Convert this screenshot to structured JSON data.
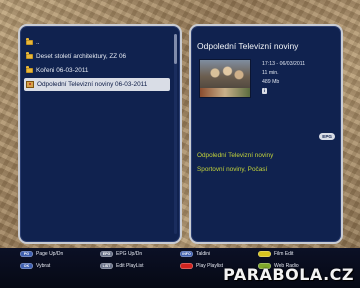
{
  "file_browser": {
    "items": [
      {
        "label": "..",
        "icon": "folder-icon",
        "selected": false
      },
      {
        "label": "Deset století architektury, ZZ 06",
        "icon": "folder-icon",
        "selected": false
      },
      {
        "label": "Kořeni 06-03-2011",
        "icon": "folder-icon",
        "selected": false
      },
      {
        "label": "Odpolední Televizní noviny 06-03-2011",
        "icon": "recording-icon",
        "selected": true
      }
    ]
  },
  "details": {
    "title": "Odpolední Televizní noviny",
    "time_range": "17:13 - 06/03/2011",
    "duration": "11 min.",
    "size": "489 Mb",
    "info_badge": "i",
    "epg_button": "EPG",
    "epg_title": "Odpolední Televizní noviny",
    "epg_desc": "Sportovní noviny, Počasí"
  },
  "legend": [
    {
      "key_color": "blue",
      "key_text": "PG",
      "label": "Page Up/Dn"
    },
    {
      "key_color": "blue",
      "key_text": "OK",
      "label": "Vybrat"
    },
    {
      "key_color": "gray",
      "key_text": "EPG",
      "label": "EPG Up/Dn"
    },
    {
      "key_color": "gray",
      "key_text": "LIST",
      "label": "Edit PlayList"
    },
    {
      "key_color": "blue",
      "key_text": "INFO",
      "label": "Taldini"
    },
    {
      "key_color": "red",
      "key_text": "",
      "label": "Play Playlist"
    },
    {
      "key_color": "yellow",
      "key_text": "",
      "label": "Film Edit"
    },
    {
      "key_color": "green",
      "key_text": "",
      "label": "Web Radio"
    }
  ],
  "watermark": "PARABOLA.CZ",
  "colors": {
    "panel_bg": "#10224f",
    "selection_bg": "#d9dde6",
    "epg_text": "#c3d33a",
    "red_key": "#d0231f",
    "yellow_key": "#d7c41f",
    "green_key": "#7fa82a"
  }
}
